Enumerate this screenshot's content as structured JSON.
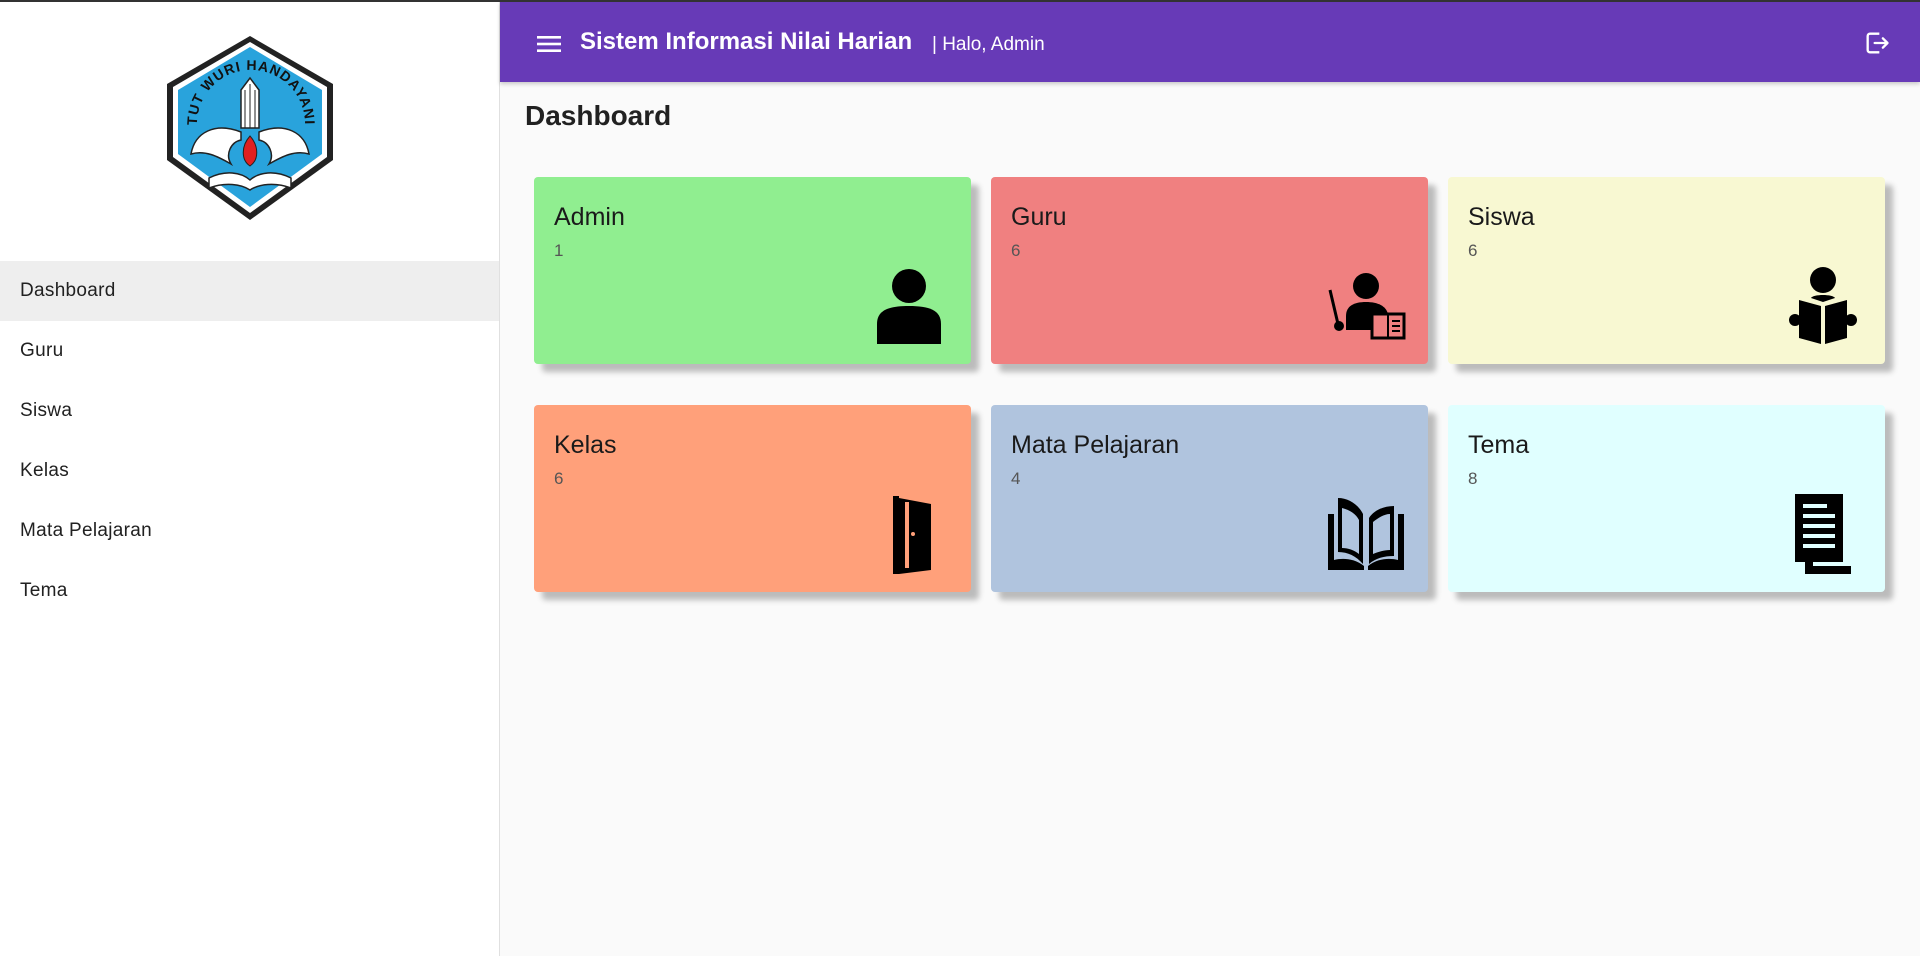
{
  "header": {
    "title": "Sistem Informasi Nilai Harian",
    "greeting": "| Halo, Admin",
    "color": "#673ab7"
  },
  "sidebar": {
    "logo_text": "TUT WURI HANDAYANI",
    "items": [
      {
        "label": "Dashboard",
        "active": true
      },
      {
        "label": "Guru"
      },
      {
        "label": "Siswa"
      },
      {
        "label": "Kelas"
      },
      {
        "label": "Mata Pelajaran"
      },
      {
        "label": "Tema"
      }
    ]
  },
  "main": {
    "page_title": "Dashboard",
    "cards": [
      {
        "title": "Admin",
        "count": "1",
        "color": "#90ee90",
        "icon": "person-icon"
      },
      {
        "title": "Guru",
        "count": "6",
        "color": "#f08080",
        "icon": "teacher-icon"
      },
      {
        "title": "Siswa",
        "count": "6",
        "color": "#f8f8d2",
        "icon": "reading-student-icon"
      },
      {
        "title": "Kelas",
        "count": "6",
        "color": "#ffa07a",
        "icon": "door-icon"
      },
      {
        "title": "Mata Pelajaran",
        "count": "4",
        "color": "#b0c4de",
        "icon": "open-book-icon"
      },
      {
        "title": "Tema",
        "count": "8",
        "color": "#e0ffff",
        "icon": "document-icon"
      }
    ]
  }
}
